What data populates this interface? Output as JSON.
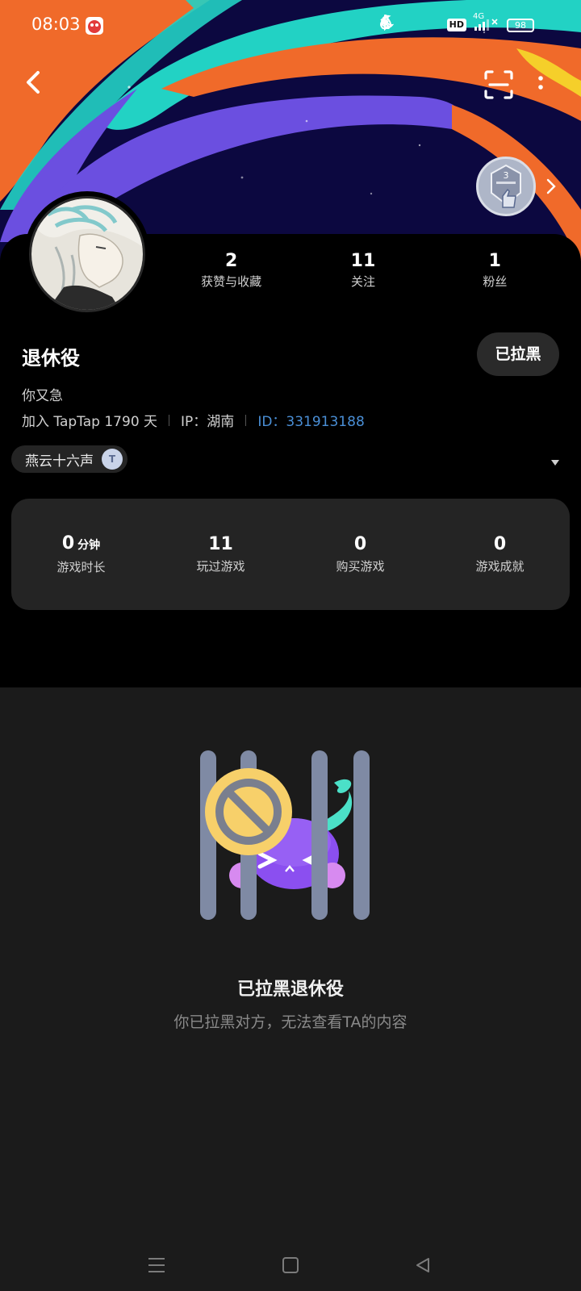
{
  "status_bar": {
    "time": "08:03",
    "hd_label": "HD",
    "network_label": "4G",
    "battery": "98",
    "icons": [
      "app-notification-icon",
      "drop-icon",
      "moon-icon",
      "bluetooth-icon",
      "signal-icon",
      "charging-icon"
    ]
  },
  "header": {
    "back_icon": "chevron-left-icon",
    "scan_icon": "scan-icon",
    "more_icon": "more-vertical-icon",
    "medal_level": "3"
  },
  "profile": {
    "stats": [
      {
        "value": "2",
        "label": "获赞与收藏"
      },
      {
        "value": "11",
        "label": "关注"
      },
      {
        "value": "1",
        "label": "粉丝"
      }
    ],
    "name": "退休役",
    "block_button": "已拉黑",
    "bio": "你又急",
    "meta": {
      "joined": "加入 TapTap 1790 天",
      "ip": "IP：湖南",
      "id": "ID：331913188"
    },
    "tag": {
      "label": "燕云十六声",
      "icon_text": "T"
    }
  },
  "game_stats": [
    {
      "value": "0",
      "unit": "分钟",
      "label": "游戏时长"
    },
    {
      "value": "11",
      "unit": "",
      "label": "玩过游戏"
    },
    {
      "value": "0",
      "unit": "",
      "label": "购买游戏"
    },
    {
      "value": "0",
      "unit": "",
      "label": "游戏成就"
    }
  ],
  "blocked": {
    "title": "已拉黑退休役",
    "subtitle": "你已拉黑对方，无法查看TA的内容"
  },
  "colors": {
    "accent_id": "#4a8fd6",
    "card_bg": "#242424",
    "page_bg": "#1b1b1b"
  }
}
